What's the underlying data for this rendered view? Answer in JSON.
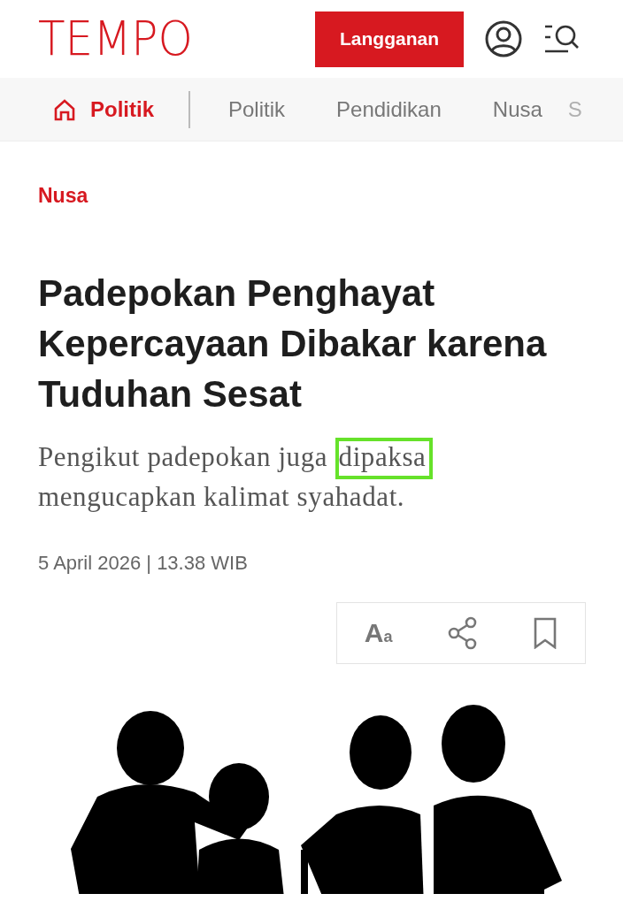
{
  "header": {
    "logo": "TEMPO",
    "subscribe_button": "Langganan"
  },
  "nav": {
    "home": {
      "label": "Politik",
      "selected": true
    },
    "items": [
      {
        "label": "Politik",
        "selected": false
      },
      {
        "label": "Pendidikan",
        "selected": false
      },
      {
        "label": "Nusa",
        "selected": false
      },
      {
        "label": "S",
        "selected": false
      }
    ]
  },
  "article": {
    "category": "Nusa",
    "title": "Padepokan Penghayat Kepercayaan Dibakar karena Tuduhan Sesat",
    "subtitle": [
      {
        "text": "Pengikut padepokan juga ",
        "highlighted": false
      },
      {
        "text": "dipaksa",
        "highlighted": true
      },
      {
        "text": " mengucapkan kalimat syahadat.",
        "highlighted": false
      }
    ],
    "date": "5 April 2026 | 13.38 WIB",
    "tools": {
      "font_big": "A",
      "font_small": "a"
    }
  }
}
